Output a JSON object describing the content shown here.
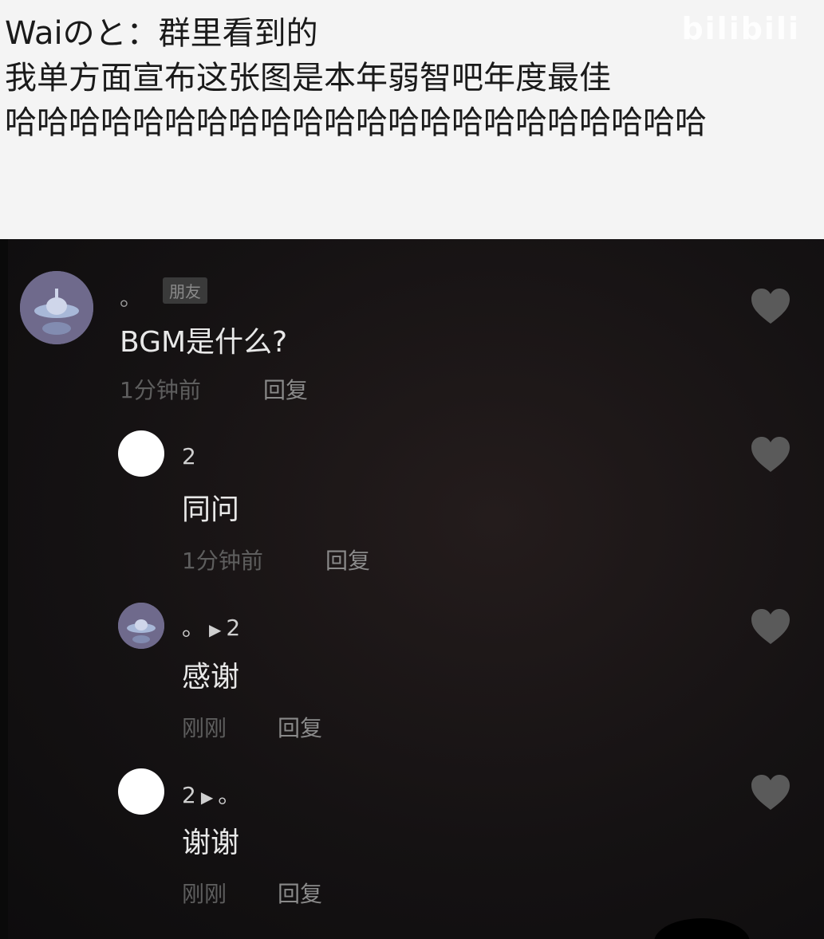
{
  "post": {
    "line1": "Waiのと：群里看到的",
    "line2": "我单方面宣布这张图是本年弱智吧年度最佳",
    "line3": "哈哈哈哈哈哈哈哈哈哈哈哈哈哈哈哈哈哈哈哈哈哈"
  },
  "watermark": {
    "logo": "bilibili"
  },
  "comments": [
    {
      "user": "。",
      "tag": "朋友",
      "text": "BGM是什么?",
      "time": "1分钟前",
      "reply": "回复"
    },
    {
      "user": "2",
      "text": "同问",
      "time": "1分钟前",
      "reply": "回复"
    },
    {
      "user_from": "。",
      "user_to": "2",
      "text": "感谢",
      "time": "刚刚",
      "reply": "回复"
    },
    {
      "user_from": "2",
      "user_to": "。",
      "text": "谢谢",
      "time": "刚刚",
      "reply": "回复"
    }
  ],
  "icons": {
    "like": "heart-icon",
    "avatar": "ufo-avatar-icon",
    "arrow": "play-arrow-icon"
  }
}
